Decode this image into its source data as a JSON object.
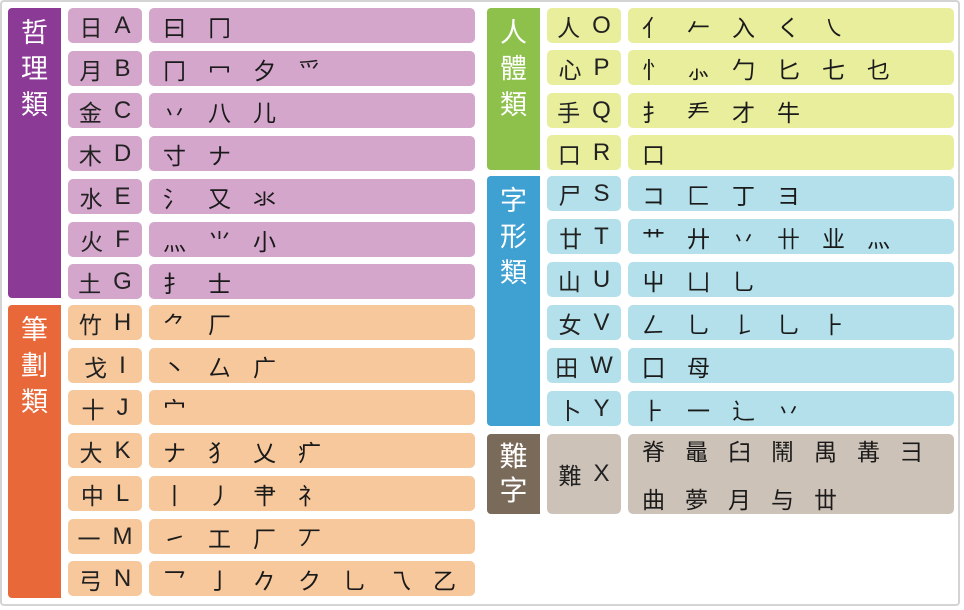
{
  "colors": {
    "philosophy_side": "#8b3a96",
    "philosophy_fill": "#d4a6cc",
    "stroke_side": "#e8683a",
    "stroke_fill": "#f6c89c",
    "body_side": "#8ec14b",
    "body_fill": "#e9ee9c",
    "shape_side": "#3fa0d2",
    "shape_fill": "#b3e0eb",
    "difficult_side": "#7a6a5a",
    "difficult_fill": "#cdc2b8"
  },
  "categories": {
    "philosophy": [
      "哲",
      "理",
      "類"
    ],
    "stroke": [
      "筆",
      "劃",
      "類"
    ],
    "body": [
      "人",
      "體",
      "類"
    ],
    "shape": [
      "字",
      "形",
      "類"
    ],
    "difficult": [
      "難",
      "字"
    ]
  },
  "rows": {
    "philosophy": [
      {
        "zh": "日",
        "en": "A",
        "roots": [
          "曰",
          "冂"
        ]
      },
      {
        "zh": "月",
        "en": "B",
        "roots": [
          "冂",
          "冖",
          "夕",
          "爫"
        ]
      },
      {
        "zh": "金",
        "en": "C",
        "roots": [
          "丷",
          "八",
          "儿"
        ]
      },
      {
        "zh": "木",
        "en": "D",
        "roots": [
          "寸",
          "ナ"
        ]
      },
      {
        "zh": "水",
        "en": "E",
        "roots": [
          "氵",
          "又",
          "氺"
        ]
      },
      {
        "zh": "火",
        "en": "F",
        "roots": [
          "灬",
          "⺌",
          "小"
        ]
      },
      {
        "zh": "土",
        "en": "G",
        "roots": [
          "扌",
          "士"
        ]
      }
    ],
    "stroke": [
      {
        "zh": "竹",
        "en": "H",
        "roots": [
          "⺈",
          "厂"
        ]
      },
      {
        "zh": "戈",
        "en": "I",
        "roots": [
          "丶",
          "厶",
          "广"
        ]
      },
      {
        "zh": "十",
        "en": "J",
        "roots": [
          "宀"
        ]
      },
      {
        "zh": "大",
        "en": "K",
        "roots": [
          "ナ",
          "犭",
          "乂",
          "疒"
        ]
      },
      {
        "zh": "中",
        "en": "L",
        "roots": [
          "丨",
          "丿",
          "肀",
          "礻"
        ]
      },
      {
        "zh": "一",
        "en": "M",
        "roots": [
          "㇀",
          "工",
          "厂",
          "丆"
        ]
      },
      {
        "zh": "弓",
        "en": "N",
        "roots": [
          "乛",
          "亅",
          "𠂊",
          "ク",
          "乚",
          "乁",
          "乙"
        ]
      }
    ],
    "body": [
      {
        "zh": "人",
        "en": "O",
        "roots": [
          "亻",
          "𠂉",
          "入",
          "く",
          "㇏"
        ]
      },
      {
        "zh": "心",
        "en": "P",
        "roots": [
          "忄",
          "⺗",
          "勹",
          "匕",
          "七",
          "乜"
        ]
      },
      {
        "zh": "手",
        "en": "Q",
        "roots": [
          "扌",
          "龵",
          "才",
          "牛"
        ]
      },
      {
        "zh": "口",
        "en": "R",
        "roots": [
          "口"
        ]
      }
    ],
    "shape": [
      {
        "zh": "尸",
        "en": "S",
        "roots": [
          "コ",
          "匚",
          "丁",
          "ヨ"
        ]
      },
      {
        "zh": "廿",
        "en": "T",
        "roots": [
          "艹",
          "廾",
          "丷",
          "卄",
          "业",
          "⺣"
        ]
      },
      {
        "zh": "山",
        "en": "U",
        "roots": [
          "屮",
          "凵",
          "乚"
        ]
      },
      {
        "zh": "女",
        "en": "V",
        "roots": [
          "𠃋",
          "乚",
          "𠄌",
          "乚",
          "⺊"
        ]
      },
      {
        "zh": "田",
        "en": "W",
        "roots": [
          "囗",
          "母"
        ]
      },
      {
        "zh": "卜",
        "en": "Y",
        "roots": [
          "⺊",
          "⼀",
          "辶",
          "丷"
        ]
      }
    ],
    "difficult": [
      {
        "zh": "難",
        "en": "X",
        "roots": [
          "脊",
          "鼂",
          "臼",
          "鬧",
          "禺",
          "冓",
          "彐",
          "曲",
          "夢",
          "月",
          "与",
          "丗"
        ]
      }
    ]
  }
}
